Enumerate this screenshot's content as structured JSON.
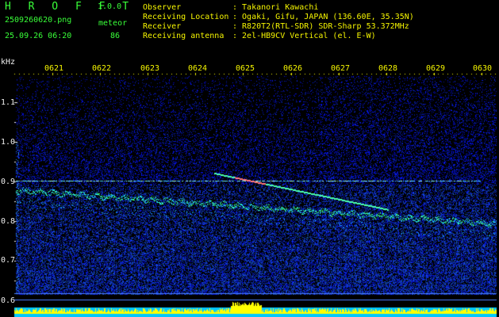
{
  "header": {
    "app_name": "H R O F F T",
    "version": "1.0.0",
    "filename": "2509260620.png",
    "mode_label": "meteor",
    "timestamp": "25.09.26 06:20",
    "count": "86"
  },
  "station_info": [
    {
      "key": "Observer",
      "value": ": Takanori Kawachi"
    },
    {
      "key": "Receiving Location",
      "value": ": Ogaki, Gifu, JAPAN (136.60E, 35.35N)"
    },
    {
      "key": "Receiver",
      "value": ": R820T2(RTL-SDR) SDR-Sharp 53.372MHz"
    },
    {
      "key": "Receiving antenna",
      "value": ": 2el-HB9CV Vertical (el. E-W)"
    }
  ],
  "y_axis": {
    "unit": "kHz",
    "ticks": [
      "1.1",
      "1.0",
      "0.9",
      "0.8",
      "0.7",
      "0.6"
    ]
  },
  "x_axis": {
    "ticks": [
      "0621",
      "0622",
      "0623",
      "0624",
      "0625",
      "0626",
      "0627",
      "0628",
      "0629",
      "0630"
    ]
  },
  "colors": {
    "background": "#000000",
    "header_green": "#39ff39",
    "info_yellow": "#f5f500",
    "bottom_bar_cyan": "#00c8ff",
    "bottom_bar_yellow": "#ffff00",
    "spectrum_blue": "#1a2aff"
  }
}
